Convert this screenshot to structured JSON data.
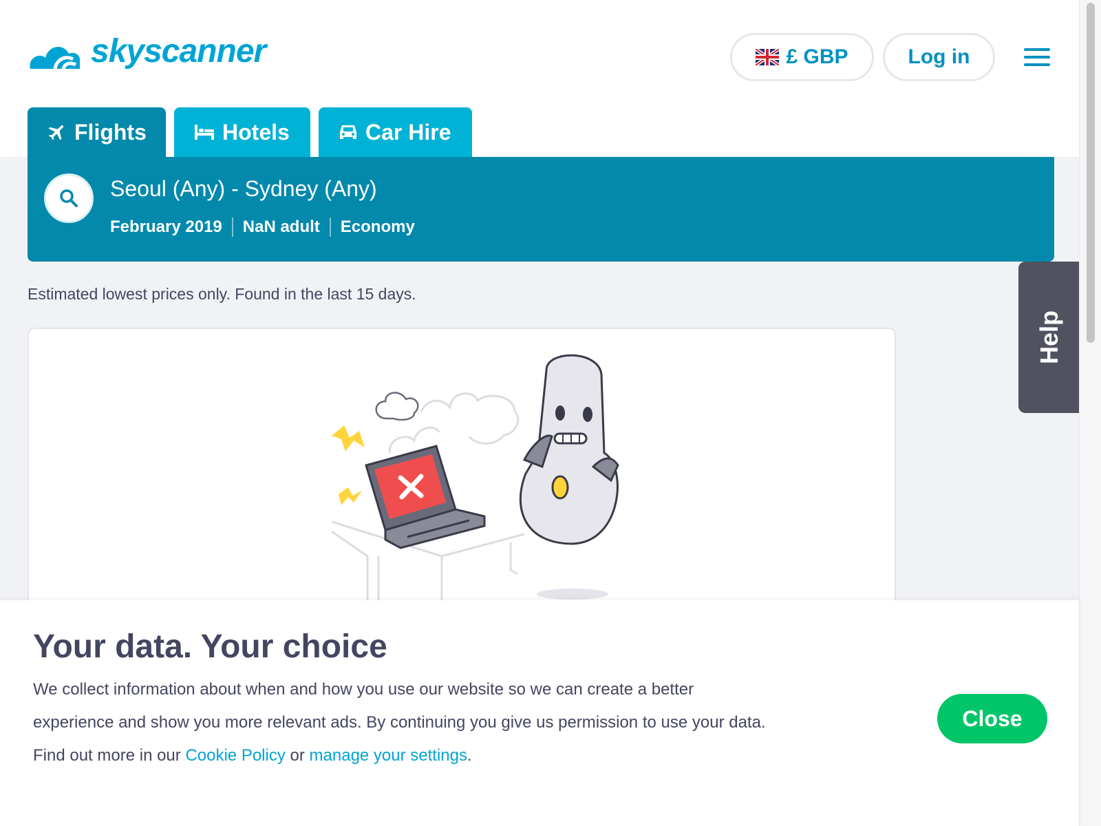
{
  "header": {
    "logo_text": "skyscanner",
    "currency_label": "£ GBP",
    "login_label": "Log in",
    "menu_icon": "hamburger-menu-icon"
  },
  "tabs": [
    {
      "label": "Flights",
      "icon": "plane-icon",
      "active": true
    },
    {
      "label": "Hotels",
      "icon": "bed-icon",
      "active": false
    },
    {
      "label": "Car Hire",
      "icon": "car-icon",
      "active": false
    }
  ],
  "search": {
    "route": "Seoul (Any) - Sydney (Any)",
    "date": "February 2019",
    "travellers": "NaN adult",
    "cabin_class": "Economy"
  },
  "note": "Estimated lowest prices only. Found in the last 15 days.",
  "help_label": "Help",
  "cookie": {
    "title": "Your data. Your choice",
    "text_part1": "We collect information about when and how you use our website so we can create a better experience and show you more relevant ads. By continuing you give us permission to use your data. Find out more in our ",
    "cookie_policy_link": "Cookie Policy",
    "text_part2": " or ",
    "settings_link": "manage your settings",
    "text_part3": ".",
    "close_label": "Close"
  },
  "colors": {
    "brand": "#00a4d4",
    "tab_active": "#0289ab",
    "tab_inactive": "#00b2d6",
    "close_button": "#00c569",
    "help_tab": "#51525f"
  }
}
